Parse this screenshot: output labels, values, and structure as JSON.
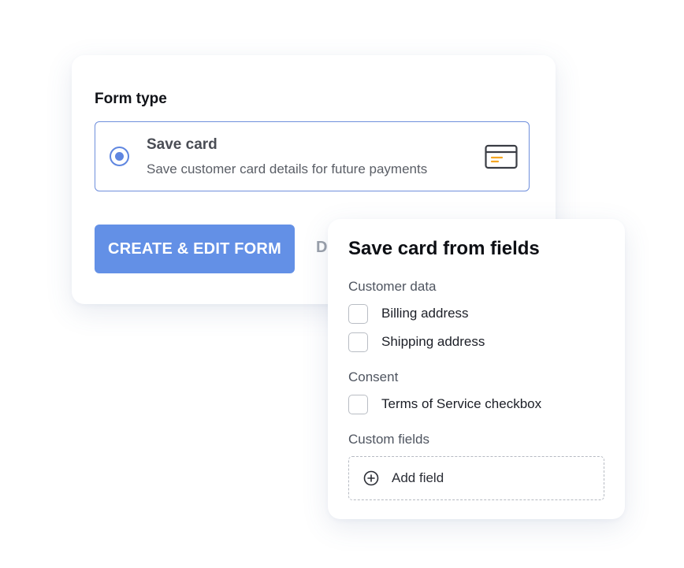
{
  "form_type": {
    "heading": "Form type",
    "option": {
      "title": "Save card",
      "description": "Save customer card details for future payments",
      "selected": true,
      "icon": "credit-card-icon"
    },
    "create_button": "CREATE & EDIT FORM",
    "secondary_button": "D"
  },
  "fields_panel": {
    "title": "Save card from fields",
    "customer_data": {
      "label": "Customer data",
      "items": [
        {
          "label": "Billing address",
          "checked": false
        },
        {
          "label": "Shipping address",
          "checked": false
        }
      ]
    },
    "consent": {
      "label": "Consent",
      "items": [
        {
          "label": "Terms of Service checkbox",
          "checked": false
        }
      ]
    },
    "custom_fields": {
      "label": "Custom fields",
      "add_label": "Add field",
      "add_icon": "plus-circle-icon"
    }
  },
  "colors": {
    "accent": "#6390E6",
    "radio": "#5F86E0",
    "card_icon_accent": "#F5A623"
  }
}
